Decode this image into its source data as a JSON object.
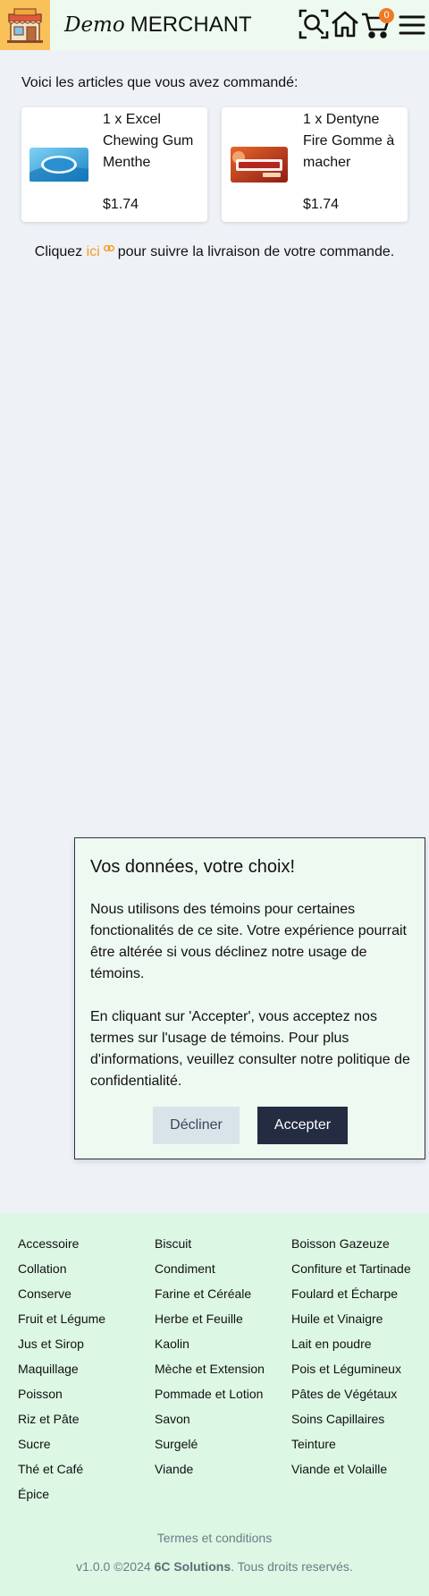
{
  "header": {
    "brand_script": "Demo",
    "brand_name": "MERCHANT",
    "cart_count": "0",
    "icons": [
      "storefront-icon",
      "search-icon",
      "home-icon",
      "cart-icon",
      "menu-icon"
    ]
  },
  "order": {
    "intro": "Voici les articles que vous avez commandé:",
    "items": [
      {
        "name": "1 x Excel Chewing Gum Menthe",
        "price": "$1.74",
        "image": "excel-gum-image"
      },
      {
        "name": "1 x Dentyne Fire Gomme à macher",
        "price": "$1.74",
        "image": "dentyne-fire-image"
      }
    ],
    "tracking_before": "Cliquez",
    "tracking_link": "ici",
    "tracking_after": "pour suivre la livraison de votre commande."
  },
  "cookie": {
    "title": "Vos données, votre choix!",
    "paragraph1": "Nous utilisons des témoins pour certaines fonctionalités de ce site. Votre expérience pourrait être altérée si vous déclinez notre usage de témoins.",
    "paragraph2": "En cliquant sur 'Accepter', vous acceptez nos termes sur l'usage de témoins. Pour plus d'informations, veuillez consulter notre politique de confidentialité.",
    "decline_label": "Décliner",
    "accept_label": "Accepter"
  },
  "footer": {
    "categories": [
      "Accessoire",
      "Biscuit",
      "Boisson Gazeuze",
      "Collation",
      "Condiment",
      "Confiture et Tartinade",
      "Conserve",
      "Farine et Céréale",
      "Foulard et Écharpe",
      "Fruit et Légume",
      "Herbe et Feuille",
      "Huile et Vinaigre",
      "Jus et Sirop",
      "Kaolin",
      "Lait en poudre",
      "Maquillage",
      "Mèche et Extension",
      "Pois et Légumineux",
      "Poisson",
      "Pommade et Lotion",
      "Pâtes de Végétaux",
      "Riz et Pâte",
      "Savon",
      "Soins Capillaires",
      "Sucre",
      "Surgelé",
      "Teinture",
      "Thé et Café",
      "Viande",
      "Viande et Volaille",
      "Épice"
    ],
    "terms": "Termes et conditions",
    "version": "v1.0.0 ©2024",
    "company": "6C Solutions",
    "rights": ". Tous droits reservés."
  },
  "colors": {
    "header_bg": "#eefaef",
    "logo_bg": "#f8c15a",
    "badge": "#f07a24",
    "link": "#f39a1d",
    "accept_bg": "#242c42",
    "decline_bg": "#d8e4ea",
    "footer_bg": "#dcf7e3"
  }
}
